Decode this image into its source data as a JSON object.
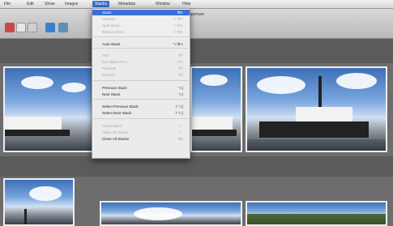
{
  "menubar": {
    "items": [
      "File",
      "Edit",
      "Show",
      "Images",
      "Stacks",
      "Metadata",
      "Window",
      "Help"
    ]
  },
  "window": {
    "title": "Aperture"
  },
  "stacks_menu": {
    "items": [
      {
        "label": "Stack",
        "shortcut": "⌘K",
        "state": "highlighted"
      },
      {
        "label": "Unstack",
        "shortcut": "⇧⌘K",
        "state": "disabled"
      },
      {
        "label": "Split Stack",
        "shortcut": "⌥⌘K",
        "state": "disabled"
      },
      {
        "label": "Extract Items",
        "shortcut": "⌥⌘K",
        "state": "disabled"
      },
      {
        "label": "Auto-Stack",
        "shortcut": "⌥⌘A",
        "state": "enabled"
      },
      {
        "label": "Pick",
        "shortcut": "⌘\\",
        "state": "disabled"
      },
      {
        "label": "Set Album Pick",
        "shortcut": "⌥⌘\\",
        "state": "disabled"
      },
      {
        "label": "Promote",
        "shortcut": "⌘[",
        "state": "disabled"
      },
      {
        "label": "Demote",
        "shortcut": "⌘]",
        "state": "disabled"
      },
      {
        "label": "Previous Stack",
        "shortcut": "⌥[",
        "state": "enabled"
      },
      {
        "label": "Next Stack",
        "shortcut": "⌥]",
        "state": "enabled"
      },
      {
        "label": "Select Previous Stack",
        "shortcut": "⇧⌥[",
        "state": "enabled"
      },
      {
        "label": "Select Next Stack",
        "shortcut": "⇧⌥]",
        "state": "enabled"
      },
      {
        "label": "Close Stack",
        "shortcut": "⌥'",
        "state": "disabled"
      },
      {
        "label": "Open All Stacks",
        "shortcut": "⌥'",
        "state": "disabled"
      },
      {
        "label": "Close All Stacks",
        "shortcut": "⌥;",
        "state": "enabled"
      }
    ]
  }
}
